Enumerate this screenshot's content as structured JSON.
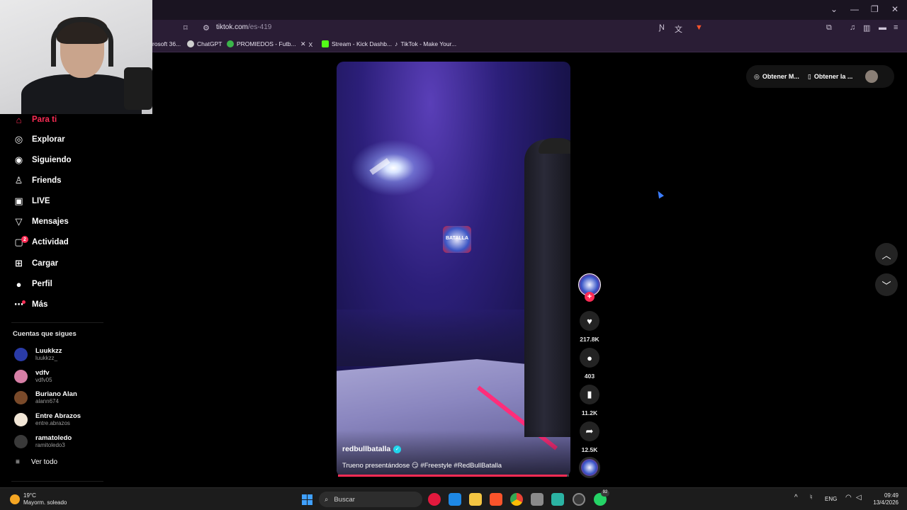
{
  "browser": {
    "url_host": "tiktok.com",
    "url_path": "/es-419",
    "bookmarks": [
      {
        "label": "rosoft 36...",
        "color": "#2a1d35"
      },
      {
        "label": "ChatGPT",
        "color": "#cfcfcf"
      },
      {
        "label": "PROMIEDOS - Futb...",
        "color": "#3bb54a"
      },
      {
        "label": "X",
        "color": "#000000"
      },
      {
        "label": "Stream - Kick Dashb...",
        "color": "#53fc18"
      },
      {
        "label": "TikTok - Make Your...",
        "color": "#000000"
      }
    ],
    "window_controls": [
      "⌄",
      "—",
      "❐",
      "✕"
    ]
  },
  "sidebar": {
    "items": [
      {
        "label": "Para ti",
        "icon": "home-icon",
        "glyph": "⌂"
      },
      {
        "label": "Explorar",
        "icon": "compass-icon",
        "glyph": "◎"
      },
      {
        "label": "Siguiendo",
        "icon": "following-avatar-icon",
        "glyph": "◉"
      },
      {
        "label": "Friends",
        "icon": "friends-icon",
        "glyph": "♙"
      },
      {
        "label": "LIVE",
        "icon": "live-icon",
        "glyph": "▣"
      },
      {
        "label": "Mensajes",
        "icon": "messages-icon",
        "glyph": "▽"
      },
      {
        "label": "Actividad",
        "icon": "activity-icon",
        "glyph": "▢"
      },
      {
        "label": "Cargar",
        "icon": "upload-icon",
        "glyph": "⊞"
      },
      {
        "label": "Perfil",
        "icon": "profile-avatar-icon",
        "glyph": "●"
      },
      {
        "label": "Más",
        "icon": "more-icon",
        "glyph": "⋯"
      }
    ],
    "activity_badge": "2",
    "following_title": "Cuentas que sigues",
    "following": [
      {
        "name": "Luukkzz",
        "handle": "luukkzz_",
        "color": "#2a3ba8"
      },
      {
        "name": "vdfv",
        "handle": "vdfv05",
        "color": "#d77fa6"
      },
      {
        "name": "Buriano Alan",
        "handle": "alann674",
        "color": "#7a4a2a"
      },
      {
        "name": "Entre Abrazos",
        "handle": "entre.abrazos",
        "color": "#f1e6d6"
      },
      {
        "name": "ramatoledo",
        "handle": "ramitoledo3",
        "color": "#3a3a3a"
      }
    ],
    "see_all": "Ver todo"
  },
  "video": {
    "author": "redbullbatalla",
    "caption": "Trueno presentándose 😏 #Freestyle #RedBullBatalla",
    "logo_text": "BATALLA",
    "progress": 0.99
  },
  "actions": {
    "likes": "217.8K",
    "comments": "403",
    "saves": "11.2K",
    "shares": "12.5K"
  },
  "top_right": {
    "button1": "Obtener M...",
    "button2": "Obtener la ..."
  },
  "taskbar": {
    "weather_temp": "19°C",
    "weather_desc": "Mayorm. soleado",
    "search_placeholder": "Buscar",
    "lang": "ENG",
    "time": "09:49",
    "date": "13/4/2026",
    "whatsapp_badge": "92"
  }
}
